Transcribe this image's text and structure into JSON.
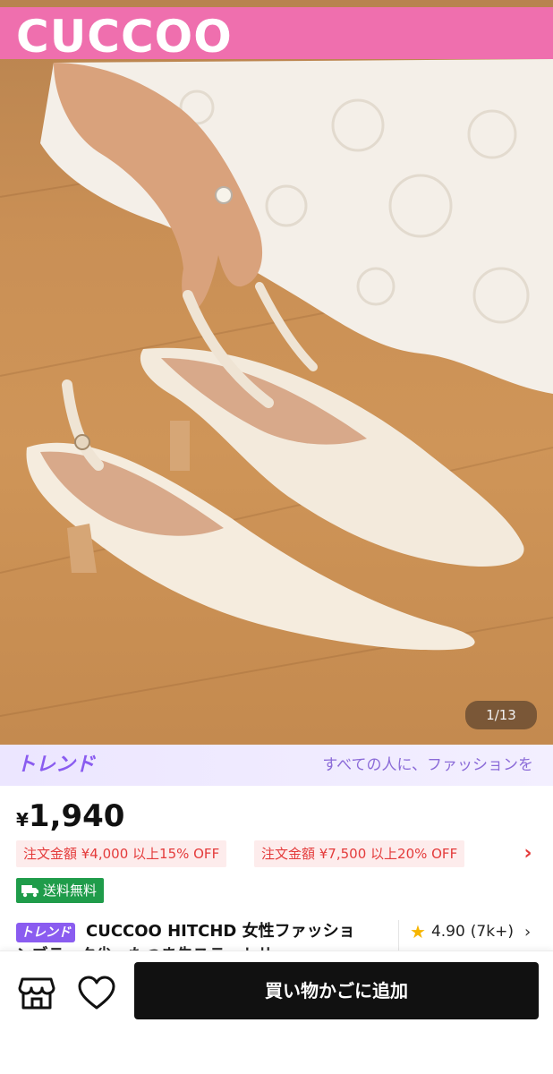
{
  "brand": {
    "logo_text": "CUCCOO",
    "banner_color": "#ef6fae"
  },
  "gallery": {
    "counter": "1/13"
  },
  "trend_banner": {
    "logo": "トレンド",
    "tagline": "すべての人に、ファッションを",
    "accent": "#8a5cf0"
  },
  "price": {
    "currency": "¥",
    "amount": "1,940"
  },
  "coupons": [
    {
      "label": "注文金額 ¥4,000 以上15% OFF"
    },
    {
      "label": "注文金額 ¥7,500 以上20% OFF"
    }
  ],
  "coupons_more_icon": "chevron-right-icon",
  "shipping": {
    "label": "送料無料",
    "icon": "truck-icon",
    "color": "#1f9c4a"
  },
  "product": {
    "trend_tag": "トレンド",
    "title_line1": "CUCCOO HITCHD 女性ファッショ",
    "title_line2": "ンブラック尖ったつま先スラットサ"
  },
  "rating": {
    "score": "4.90",
    "count": "(7k+)",
    "icon": "star-icon"
  },
  "bottom_bar": {
    "store_icon": "store-icon",
    "favorite_icon": "heart-icon",
    "add_to_cart": "買い物かごに追加"
  }
}
